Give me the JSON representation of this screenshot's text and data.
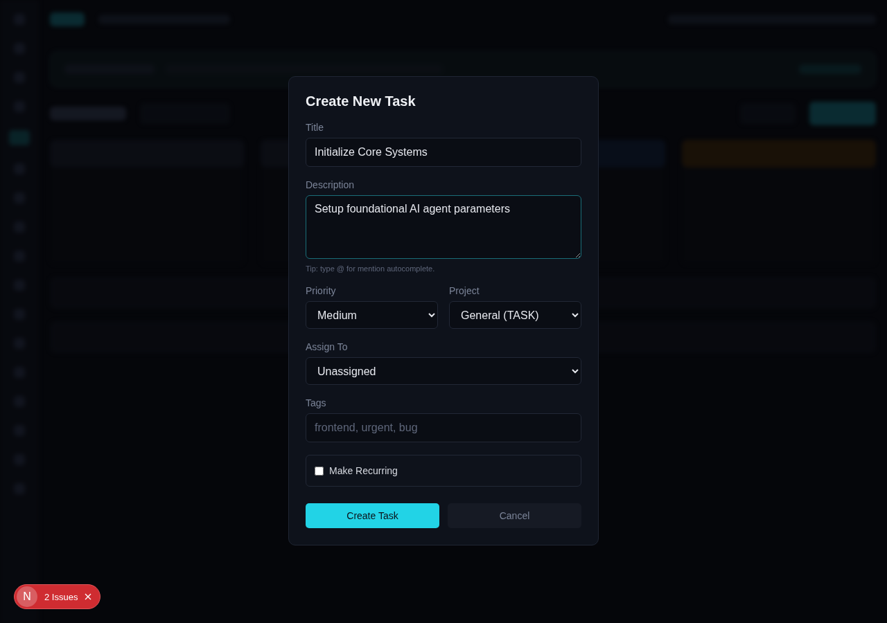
{
  "dialog": {
    "title": "Create New Task",
    "fields": [
      {
        "kind": "text",
        "label": "Title",
        "value": "Initialize Core Systems"
      },
      {
        "kind": "textarea",
        "label": "Description",
        "value": "Setup foundational AI agent parameters",
        "focused": true,
        "hint": "Tip: type @ for mention autocomplete."
      },
      {
        "kind": "select-pair",
        "items": [
          {
            "label": "Priority",
            "value": "Medium"
          },
          {
            "label": "Project",
            "value": "General (TASK)"
          }
        ]
      },
      {
        "kind": "select",
        "label": "Assign To",
        "value": "Unassigned"
      },
      {
        "kind": "text",
        "label": "Tags",
        "placeholder": "frontend, urgent, bug"
      },
      {
        "kind": "checkbox",
        "label": "Make Recurring",
        "checked": false
      }
    ],
    "buttons": [
      {
        "label": "Create Task",
        "kind": "primary"
      },
      {
        "label": "Cancel",
        "kind": "secondary"
      }
    ]
  },
  "issues_badge": {
    "letter": "N",
    "label": "2 Issues"
  }
}
